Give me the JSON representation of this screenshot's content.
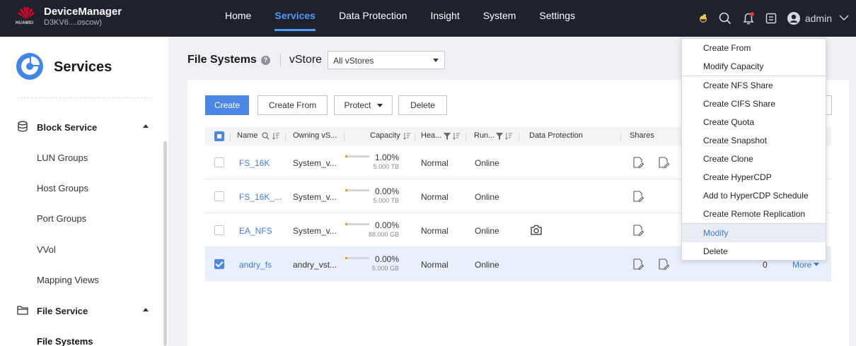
{
  "app": {
    "name": "DeviceManager",
    "vendor": "HUAWEI",
    "device": "D3KV6....oscow)"
  },
  "nav": {
    "items": [
      "Home",
      "Services",
      "Data Protection",
      "Insight",
      "System",
      "Settings"
    ],
    "active": "Services"
  },
  "user": {
    "name": "admin"
  },
  "sidebar": {
    "title": "Services",
    "block_service": {
      "label": "Block Service",
      "items": [
        "LUN Groups",
        "Host Groups",
        "Port Groups",
        "VVol",
        "Mapping Views"
      ]
    },
    "file_service": {
      "label": "File Service",
      "items": [
        "File Systems"
      ]
    }
  },
  "page": {
    "title": "File Systems",
    "vstore_label": "vStore",
    "vstore_value": "All vStores"
  },
  "toolbar": {
    "create": "Create",
    "create_from": "Create From",
    "protect": "Protect",
    "delete": "Delete"
  },
  "table": {
    "headers": {
      "name": "Name",
      "owning": "Owning vS...",
      "capacity": "Capacity",
      "health": "Hea...",
      "running": "Run...",
      "protection": "Data Protection",
      "shares": "Shares"
    },
    "rows": [
      {
        "name": "FS_16K",
        "owning": "System_v...",
        "pct": "1.00%",
        "used_fraction": 0.01,
        "total": "5.000 TB",
        "health": "Normal",
        "running": "Online",
        "protection_icon": "",
        "share_icons": 2,
        "selected": false,
        "count": "",
        "more": ""
      },
      {
        "name": "FS_16K_...",
        "owning": "System_v...",
        "pct": "0.00%",
        "used_fraction": 0.0,
        "total": "5.000 TB",
        "health": "Normal",
        "running": "Online",
        "protection_icon": "",
        "share_icons": 1,
        "selected": false,
        "count": "",
        "more": ""
      },
      {
        "name": "EA_NFS",
        "owning": "System_v...",
        "pct": "0.00%",
        "used_fraction": 0.0,
        "total": "88.000 GB",
        "health": "Normal",
        "running": "Online",
        "protection_icon": "camera-icon",
        "share_icons": 1,
        "selected": false,
        "count": "",
        "more": ""
      },
      {
        "name": "andry_fs",
        "owning": "andry_vst...",
        "pct": "0.00%",
        "used_fraction": 0.0,
        "total": "5.000 GB",
        "health": "Normal",
        "running": "Online",
        "protection_icon": "",
        "share_icons": 2,
        "selected": true,
        "count": "0",
        "more": "More"
      }
    ]
  },
  "more_menu": {
    "items": [
      "Create From",
      "Modify Capacity",
      "Create NFS Share",
      "Create CIFS Share",
      "Create Quota",
      "Create Snapshot",
      "Create Clone",
      "Create HyperCDP",
      "Add to HyperCDP Schedule",
      "Create Remote Replication",
      "Modify",
      "Delete"
    ],
    "highlighted": "Modify"
  },
  "colors": {
    "topbar": "#1f222b",
    "accent": "#4d9bff",
    "primary_button": "#4b88e6",
    "link": "#3b7ddd"
  }
}
